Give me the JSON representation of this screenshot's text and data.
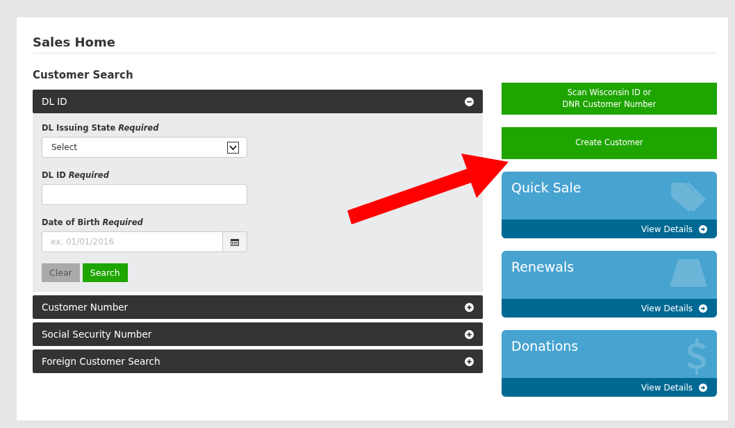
{
  "page": {
    "title": "Sales Home"
  },
  "search": {
    "heading": "Customer Search",
    "sections": [
      {
        "label": "DL ID",
        "expanded": true
      },
      {
        "label": "Customer Number",
        "expanded": false
      },
      {
        "label": "Social Security Number",
        "expanded": false
      },
      {
        "label": "Foreign Customer Search",
        "expanded": false
      }
    ],
    "fields": [
      {
        "kind": "select",
        "label": "DL Issuing State *Required*",
        "value": "Select"
      },
      {
        "kind": "text",
        "label": "DL ID *Required*"
      },
      {
        "kind": "date",
        "label": "Date of Birth *Required*",
        "placeholder": "ex. 01/01/2016"
      }
    ],
    "buttons": [
      {
        "kind": "clear",
        "label": "Clear"
      },
      {
        "kind": "search",
        "label": "Search"
      }
    ]
  },
  "actions": [
    "Scan Wisconsin ID or\nDNR Customer Number",
    "Create Customer"
  ],
  "tiles": [
    {
      "title": "Quick Sale",
      "kind": "tags",
      "link": "View Details"
    },
    {
      "title": "Renewals",
      "kind": "road",
      "link": "View Details"
    },
    {
      "title": "Donations",
      "kind": "dollar",
      "link": "View Details"
    }
  ]
}
